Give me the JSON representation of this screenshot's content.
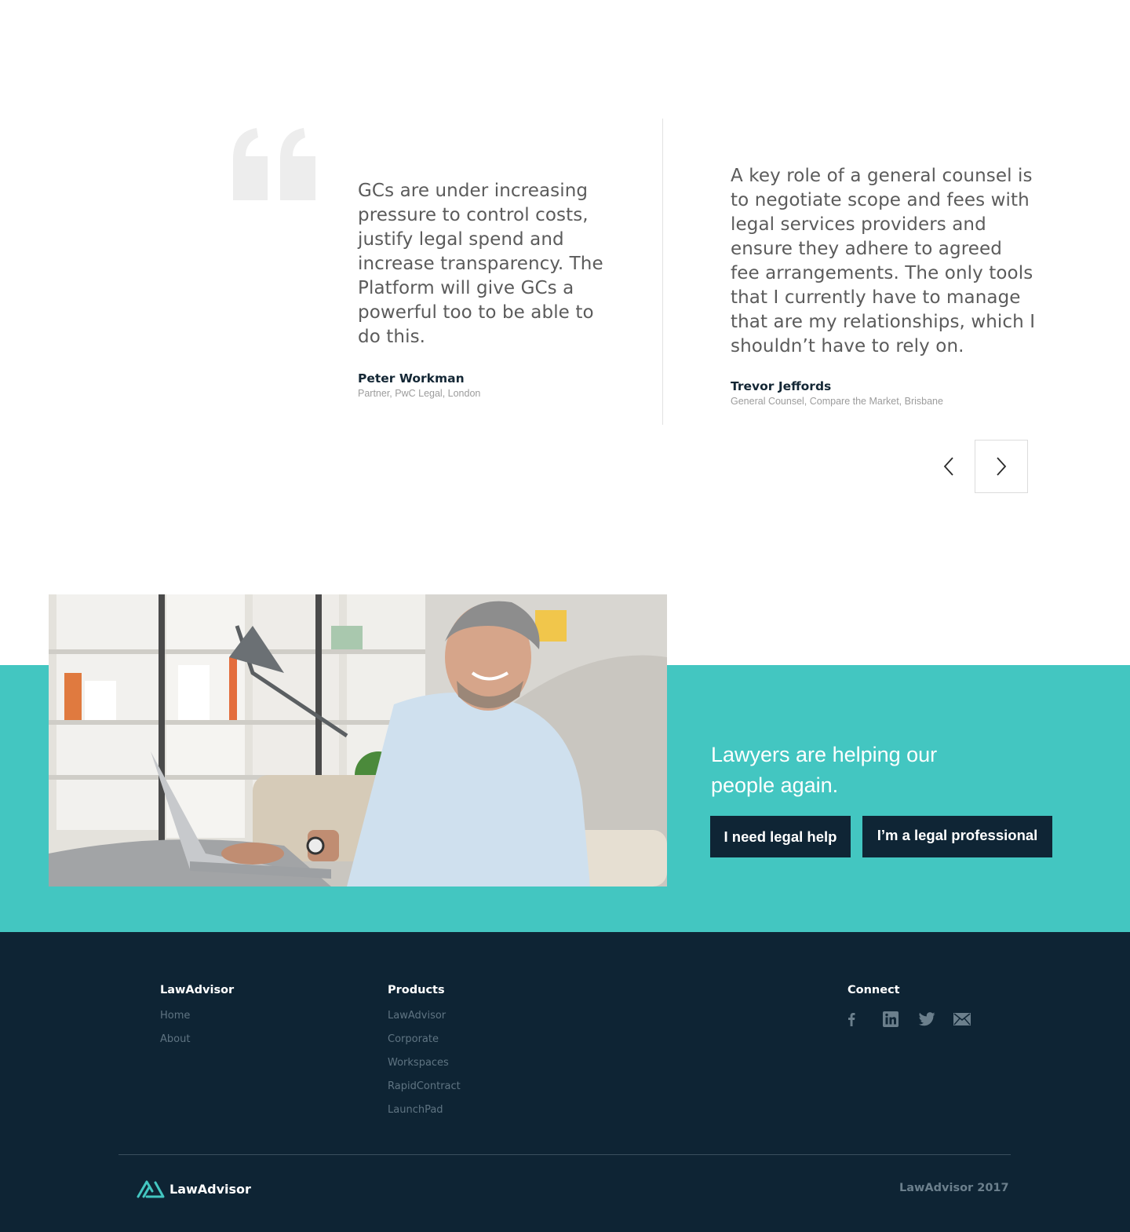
{
  "testimonials": [
    {
      "quote": "GCs are under increasing pressure to control costs, justify legal spend and increase transparency. The Platform will give GCs a powerful too to be able to do this.",
      "name": "Peter Workman",
      "role": "Partner, PwC Legal, London"
    },
    {
      "quote": "A key role of a general counsel is to negotiate scope and fees with legal services providers and ensure they adhere to agreed fee arrangements. The only tools that I currently have to manage that are my relationships, which I shouldn’t have to rely on.",
      "name": "Trevor Jeffords",
      "role": "General Counsel, Compare the Market, Brisbane"
    }
  ],
  "carousel": {
    "prev_icon": "chevron-left-icon",
    "next_icon": "chevron-right-icon"
  },
  "cta": {
    "heading": "Lawyers are helping our people again.",
    "primary_button": "I need legal help",
    "secondary_button": "I’m a legal professional",
    "background_color": "#43c6c1",
    "button_color": "#0f2535"
  },
  "footer": {
    "columns": [
      {
        "title": "LawAdvisor",
        "links": [
          "Home",
          "About"
        ]
      },
      {
        "title": "Products",
        "links": [
          "LawAdvisor",
          "Corporate",
          "Workspaces",
          "RapidContract",
          "LaunchPad"
        ]
      },
      {
        "title": "Connect",
        "social": [
          "facebook-icon",
          "linkedin-icon",
          "twitter-icon",
          "email-icon"
        ]
      }
    ],
    "brand": "LawAdvisor",
    "copyright": "LawAdvisor 2017",
    "background_color": "#0e2434"
  }
}
